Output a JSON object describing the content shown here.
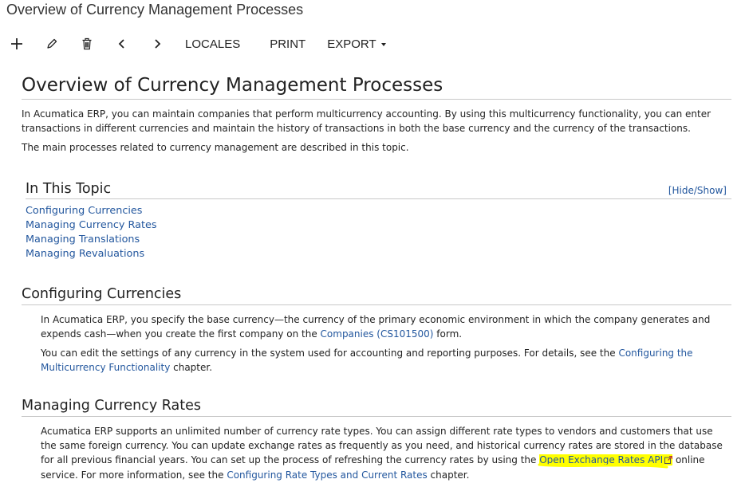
{
  "window": {
    "title": "Overview of Currency Management Processes"
  },
  "toolbar": {
    "add_icon": "plus-icon",
    "edit_icon": "pencil-icon",
    "delete_icon": "trash-icon",
    "prev_icon": "chevron-left-icon",
    "next_icon": "chevron-right-icon",
    "locales_label": "LOCALES",
    "print_label": "PRINT",
    "export_label": "EXPORT"
  },
  "article": {
    "title": "Overview of Currency Management Processes",
    "intro_p1": "In Acumatica ERP, you can maintain companies that perform multicurrency accounting. By using this multicurrency functionality, you can enter transactions in different currencies and maintain the history of transactions in both the base currency and the currency of the transactions.",
    "intro_p2": "The main processes related to currency management are described in this topic.",
    "toc": {
      "title": "In This Topic",
      "toggle": "[Hide/Show]",
      "items": [
        "Configuring Currencies",
        "Managing Currency Rates",
        "Managing Translations",
        "Managing Revaluations"
      ]
    },
    "sec1": {
      "title": "Configuring Currencies",
      "p1_a": "In Acumatica ERP, you specify the base currency—the currency of the primary economic environment in which the company generates and expends cash—when you create the first company on the ",
      "p1_link": "Companies (CS101500)",
      "p1_b": " form.",
      "p2_a": "You can edit the settings of any currency in the system used for accounting and reporting purposes. For details, see the ",
      "p2_link": "Configuring the Multicurrency Functionality",
      "p2_b": " chapter."
    },
    "sec2": {
      "title": "Managing Currency Rates",
      "p1_a": "Acumatica ERP supports an unlimited number of currency rate types. You can assign different rate types to vendors and customers that use the same foreign currency. You can update exchange rates as frequently as you need, and historical currency rates are stored in the database for all previous financial years. You can set up the process of refreshing the currency rates by using the ",
      "p1_link": "Open Exchange Rates API",
      "p1_b": " online service. For more information, see the ",
      "p1_link2": "Configuring Rate Types and Current Rates",
      "p1_c": " chapter."
    }
  },
  "colors": {
    "link": "#23579e",
    "highlight": "#ffff00",
    "rule": "#c8c8c8"
  }
}
